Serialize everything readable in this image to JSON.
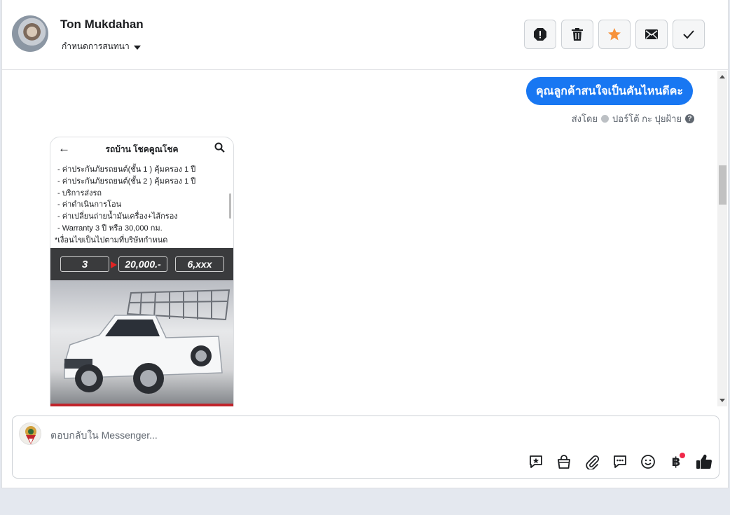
{
  "header": {
    "name": "Ton Mukdahan",
    "assign_label": "กำหนดการสนทนา"
  },
  "actions": [
    {
      "name": "report-button",
      "icon": "alert-icon"
    },
    {
      "name": "delete-button",
      "icon": "trash-icon"
    },
    {
      "name": "star-button",
      "icon": "star-icon"
    },
    {
      "name": "mark-unread-button",
      "icon": "envelope-icon"
    },
    {
      "name": "done-button",
      "icon": "check-icon"
    }
  ],
  "message": {
    "text": "คุณลูกค้าสนใจเป็นคันไหนดีคะ",
    "sent_prefix": "ส่งโดย",
    "sender": "ปอร์โต้ กะ ปุยฝ้าย"
  },
  "card": {
    "title": "รถบ้าน โชคคูณโชค",
    "items": [
      "- ค่าประกันภัยรถยนต์(ชั้น 1 ) คุ้มครอง 1 ปี",
      "- ค่าประกันภัยรถยนต์(ชั้น 2 ) คุ้มครอง 1 ปี",
      "- บริการส่งรถ",
      "- ค่าดำเนินการโอน",
      "- ค่าเปลี่ยนถ่ายน้ำมันเครื่อง+ไส้กรอง",
      "- Warranty 3 ปี หรือ 30,000 กม."
    ],
    "note": "*เงื่อนไขเป็นไปตามที่บริษัทกำหนด",
    "chip_a": "3",
    "chip_b": "20,000.-",
    "chip_c": "6,xxx"
  },
  "composer": {
    "placeholder": "ตอบกลับใน Messenger..."
  },
  "colors": {
    "accent": "#1877f2",
    "star": "#f7923b",
    "badge": "#f02849"
  }
}
